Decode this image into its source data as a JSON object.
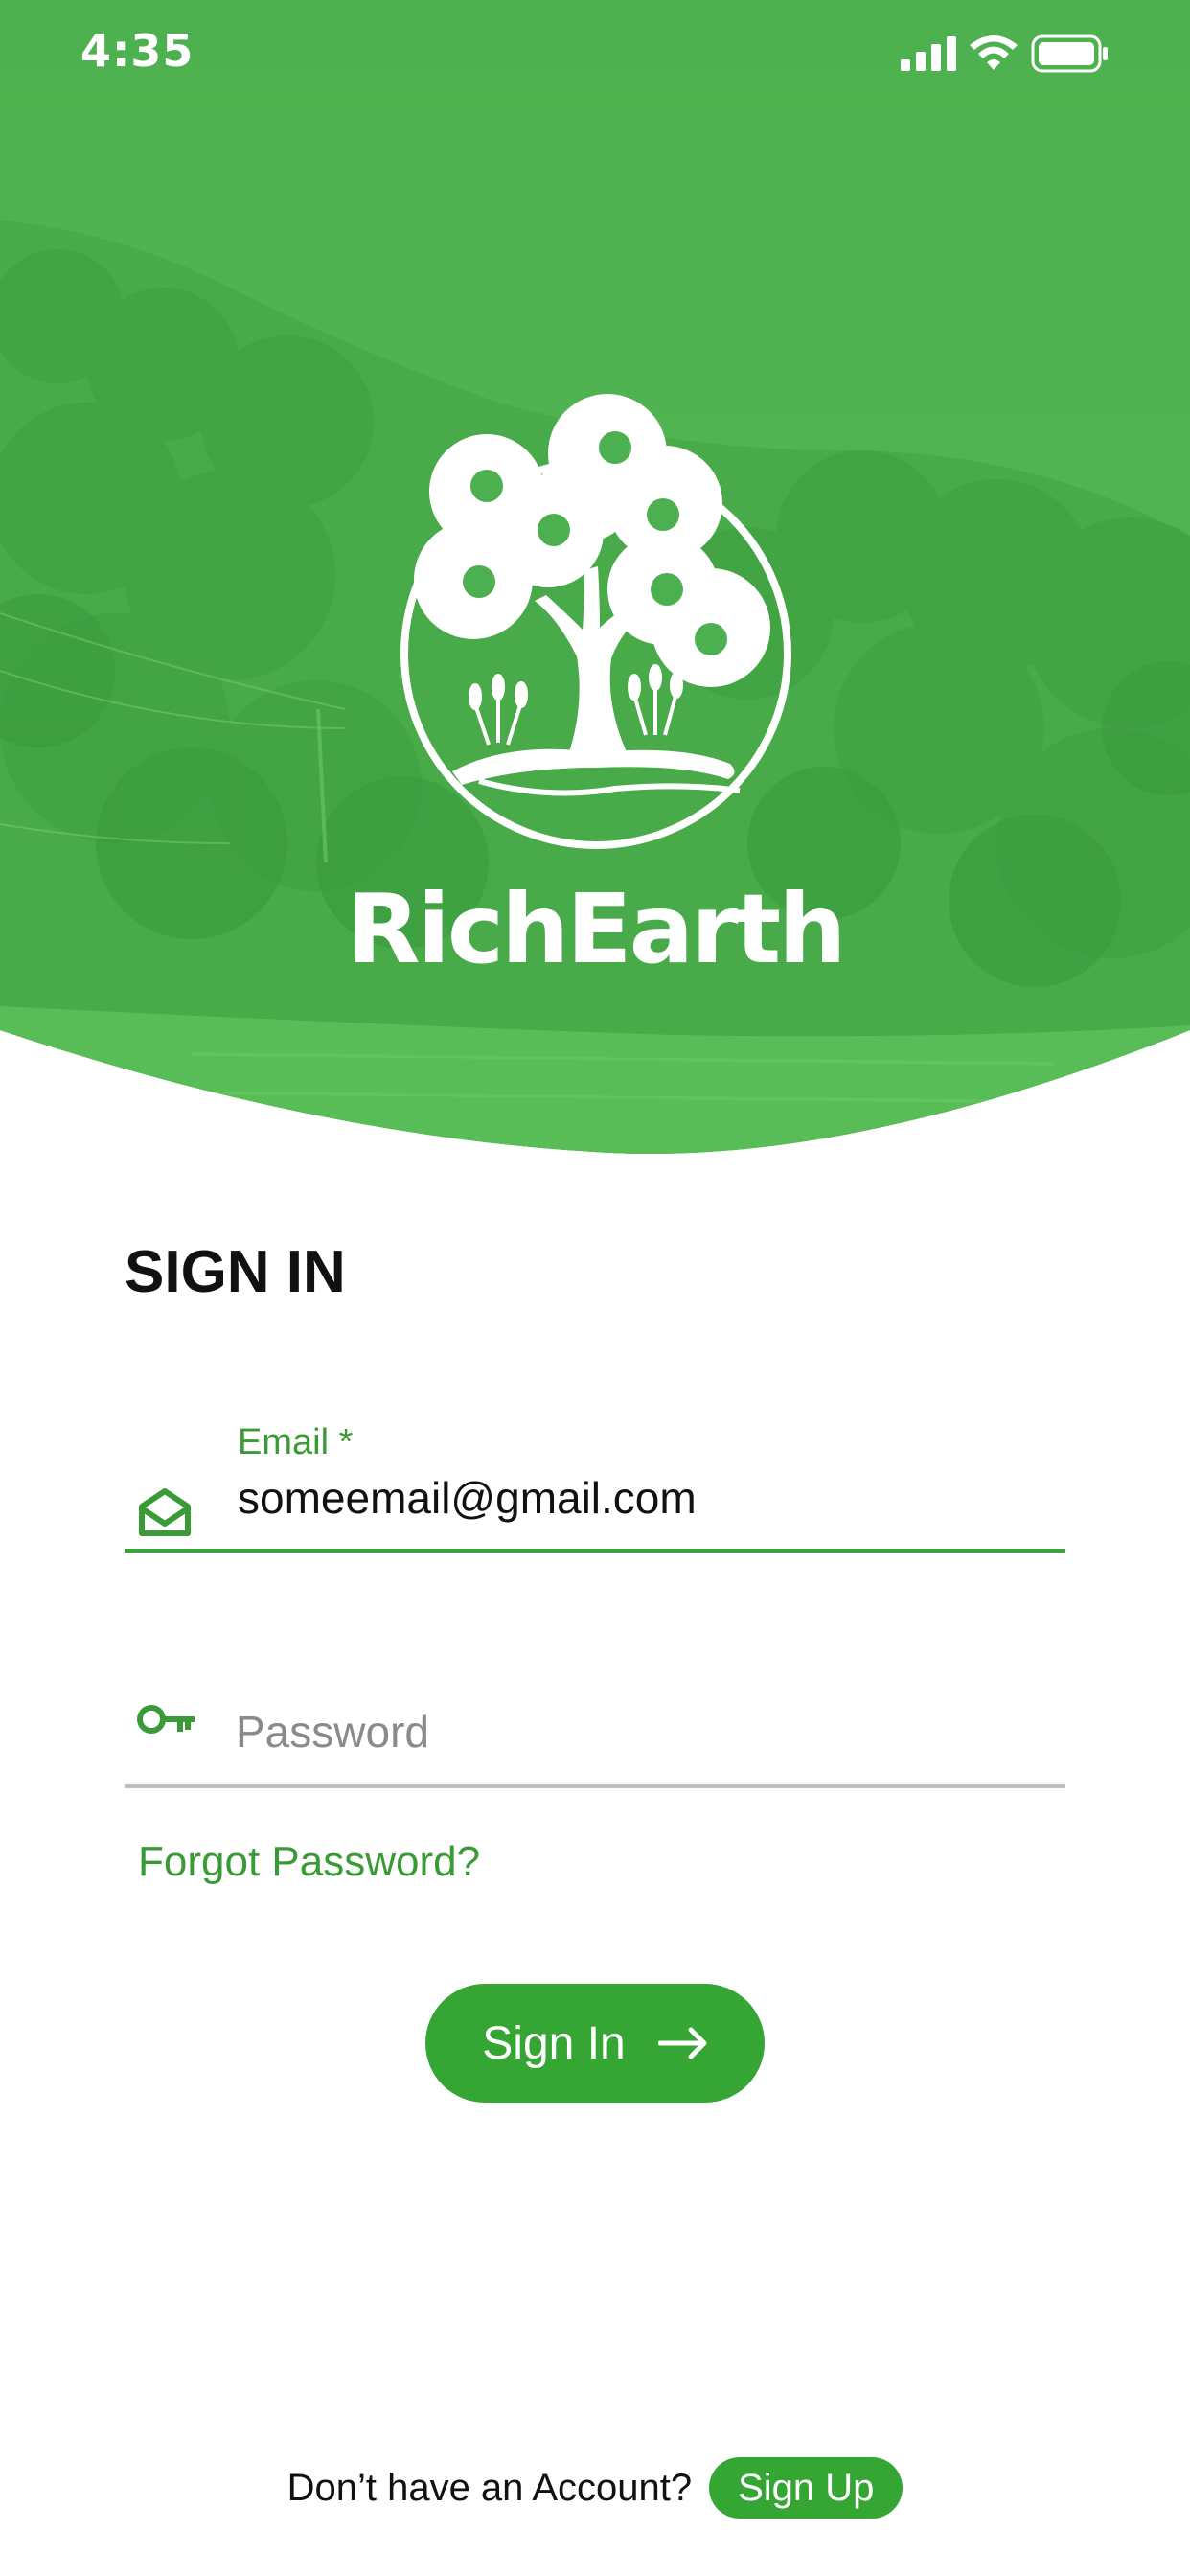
{
  "status_bar": {
    "time": "4:35",
    "icons": [
      "cellular-signal-icon",
      "wifi-icon",
      "battery-icon"
    ]
  },
  "brand": {
    "name": "RichEarth",
    "logo_icon": "tree-logo-icon"
  },
  "form": {
    "title": "SIGN IN",
    "email": {
      "label": "Email *",
      "value": "someemail@gmail.com",
      "icon": "envelope-icon"
    },
    "password": {
      "placeholder": "Password",
      "icon": "key-icon"
    },
    "forgot_password": "Forgot Password?",
    "submit_label": "Sign In",
    "submit_icon": "arrow-right-icon"
  },
  "footer": {
    "prompt": "Don’t have an Account?",
    "signup_label": "Sign Up"
  },
  "colors": {
    "primary_green": "#35a534",
    "label_green": "#3a9b36",
    "hero_green": "#4caf50"
  }
}
